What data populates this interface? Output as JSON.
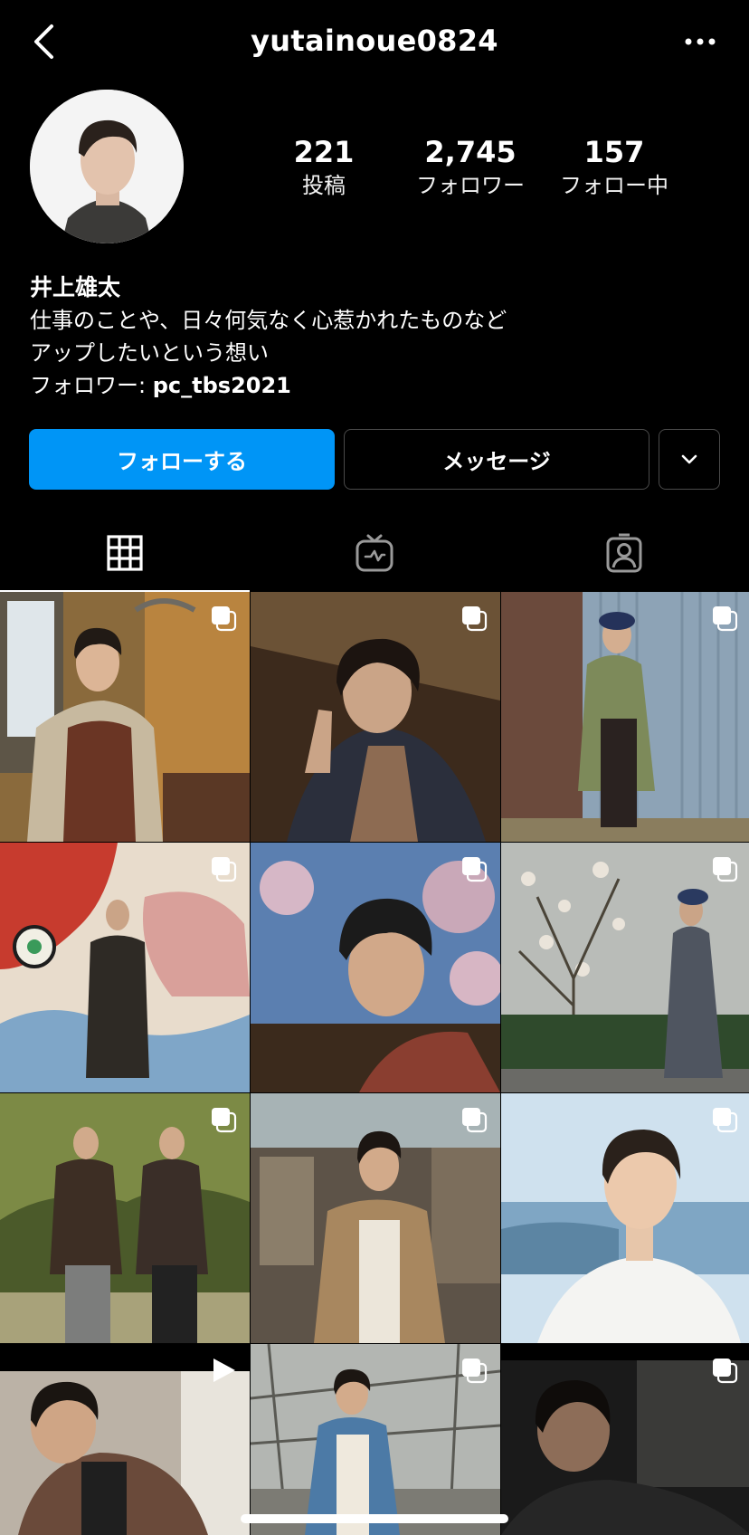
{
  "header": {
    "username": "yutainoue0824",
    "back_icon": "chevron-left-icon",
    "more_icon": "ellipsis-icon"
  },
  "profile": {
    "stats": [
      {
        "value": "221",
        "label": "投稿"
      },
      {
        "value": "2,745",
        "label": "フォロワー"
      },
      {
        "value": "157",
        "label": "フォロー中"
      }
    ],
    "name": "井上雄太",
    "bio_lines": [
      "仕事のことや、日々何気なく心惹かれたものなど",
      "アップしたいという想い"
    ],
    "followed_by_prefix": "フォロワー: ",
    "followed_by_user": "pc_tbs2021"
  },
  "actions": {
    "follow_label": "フォローする",
    "message_label": "メッセージ",
    "more_icon": "chevron-down-icon"
  },
  "tabs": [
    {
      "icon": "grid-icon",
      "active": true
    },
    {
      "icon": "igtv-icon",
      "active": false
    },
    {
      "icon": "tagged-icon",
      "active": false
    }
  ],
  "posts": [
    {
      "name": "post-1",
      "badge": "carousel-icon"
    },
    {
      "name": "post-2",
      "badge": "carousel-icon"
    },
    {
      "name": "post-3",
      "badge": "carousel-icon"
    },
    {
      "name": "post-4",
      "badge": "carousel-icon"
    },
    {
      "name": "post-5",
      "badge": "carousel-icon"
    },
    {
      "name": "post-6",
      "badge": "carousel-icon"
    },
    {
      "name": "post-7",
      "badge": "carousel-icon"
    },
    {
      "name": "post-8",
      "badge": "carousel-icon"
    },
    {
      "name": "post-9",
      "badge": "carousel-icon"
    },
    {
      "name": "post-10",
      "badge": "reel-icon"
    },
    {
      "name": "post-11",
      "badge": "carousel-icon"
    },
    {
      "name": "post-12",
      "badge": "carousel-icon"
    }
  ],
  "colors": {
    "accent": "#0095f6",
    "background": "#000000",
    "border": "#4a4a4a"
  }
}
